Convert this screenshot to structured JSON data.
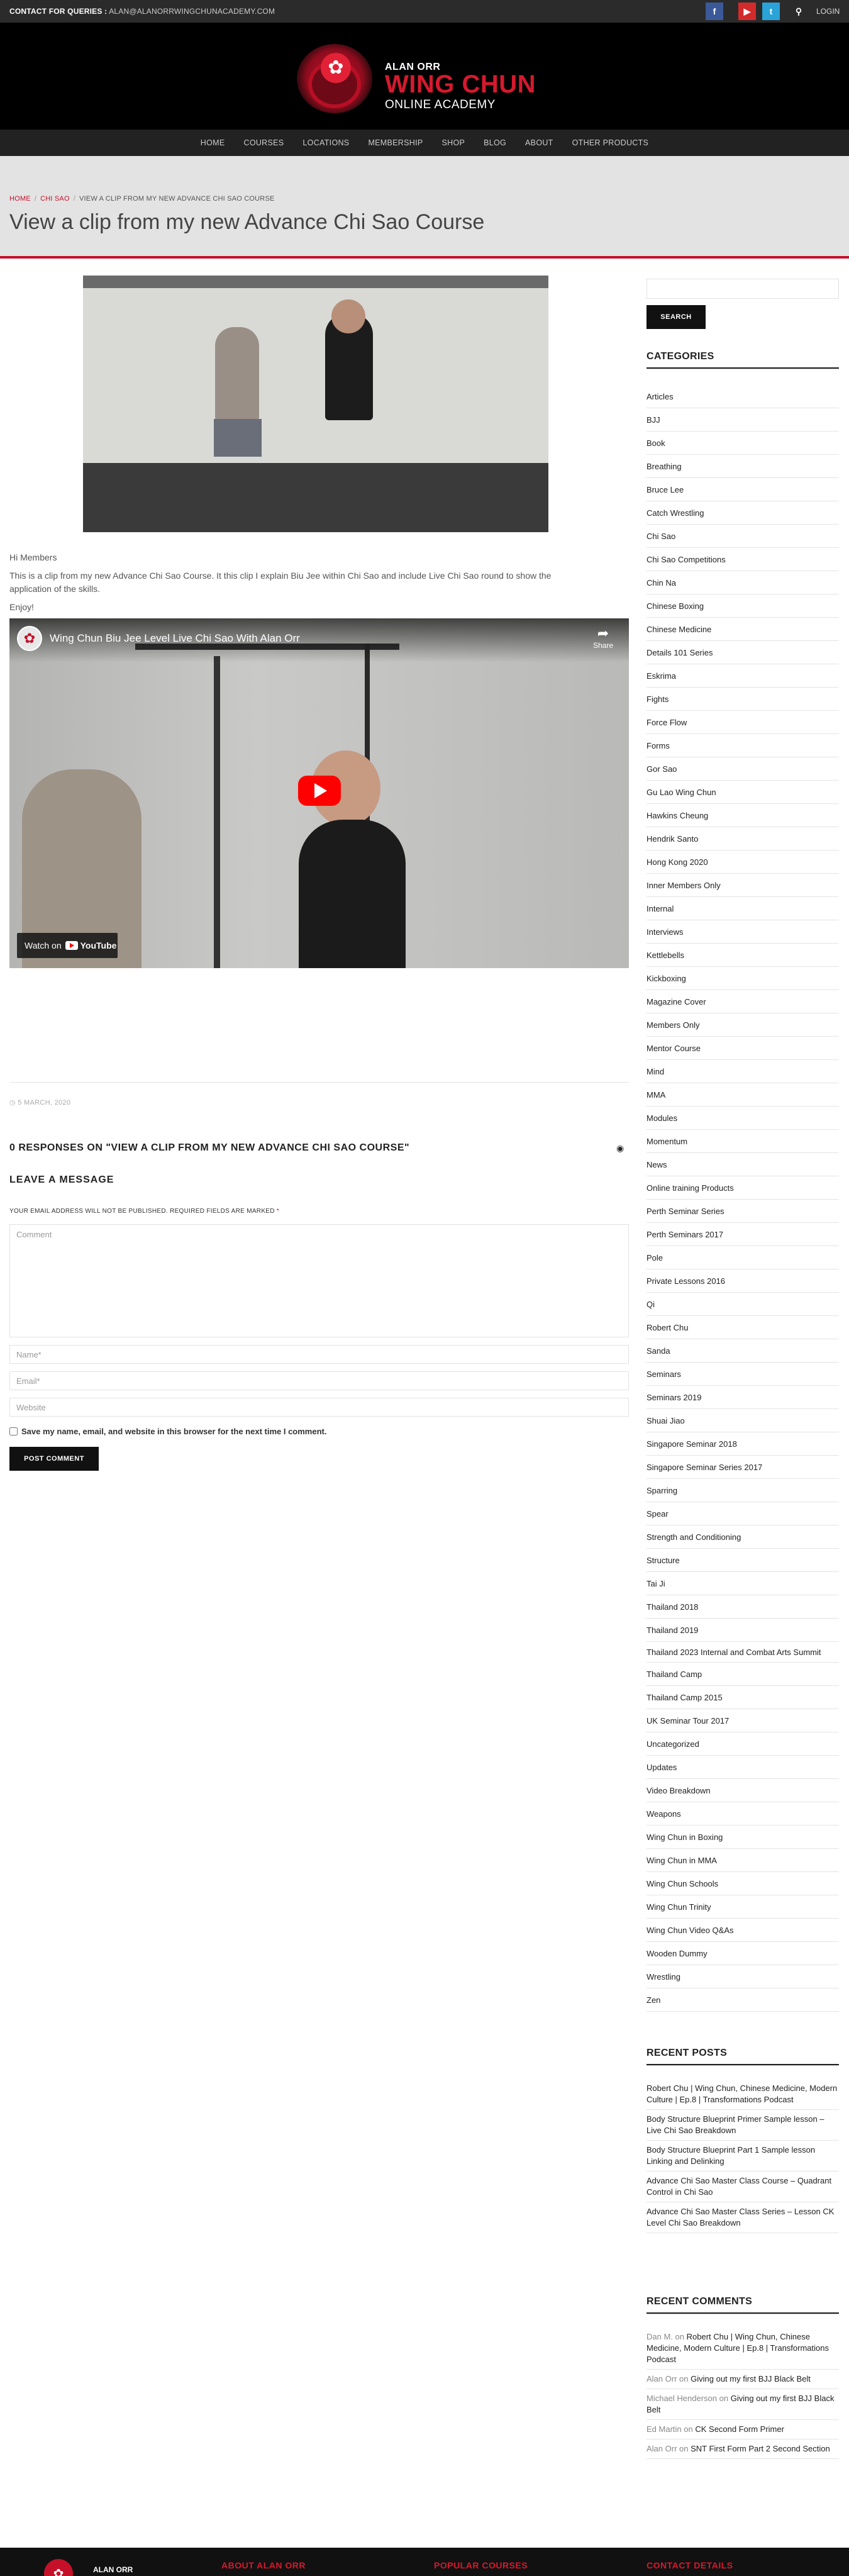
{
  "topbar": {
    "contact_label": "CONTACT FOR QUERIES :",
    "contact_email": "ALAN@ALANORRWINGCHUNACADEMY.COM",
    "facebook_icon": "f",
    "youtube_icon": "▶",
    "twitter_icon": "t",
    "search_icon": "⚲",
    "login": "LOGIN"
  },
  "logo": {
    "line1": "ALAN ORR",
    "line2": "WING CHUN",
    "line3": "ONLINE ACADEMY"
  },
  "nav": [
    "HOME",
    "COURSES",
    "LOCATIONS",
    "MEMBERSHIP",
    "SHOP",
    "BLOG",
    "ABOUT",
    "OTHER PRODUCTS"
  ],
  "breadcrumb": {
    "home": "HOME",
    "category": "CHI SAO",
    "current": "VIEW A CLIP FROM MY NEW ADVANCE CHI SAO COURSE",
    "separator": "/"
  },
  "page_title": "View a clip from my new Advance Chi Sao Course",
  "content": {
    "greeting": "Hi Members",
    "body": "This is a clip from my new Advance Chi Sao Course. It this clip I explain Biu Jee within Chi Sao and include Live Chi Sao round to show the application of the skills.",
    "signoff": "Enjoy!"
  },
  "video": {
    "title": "Wing Chun Biu Jee Level Live Chi Sao With Alan Orr",
    "share": "Share",
    "watch_on": "Watch on",
    "youtube": "YouTube"
  },
  "post_date": "5 MARCH, 2020",
  "responses_heading": "0 RESPONSES ON \"VIEW A CLIP FROM MY NEW ADVANCE CHI SAO COURSE\"",
  "comment_form": {
    "heading": "LEAVE A MESSAGE",
    "note": "YOUR EMAIL ADDRESS WILL NOT BE PUBLISHED. REQUIRED FIELDS ARE MARKED",
    "required_mark": "*",
    "comment_placeholder": "Comment",
    "name_placeholder": "Name*",
    "email_placeholder": "Email*",
    "website_placeholder": "Website",
    "save_label": "Save my name, email, and website in this browser for the next time I comment.",
    "submit": "POST COMMENT"
  },
  "sidebar": {
    "search_button": "SEARCH",
    "categories_heading": "CATEGORIES",
    "categories": [
      "Articles",
      "BJJ",
      "Book",
      "Breathing",
      "Bruce Lee",
      "Catch Wrestling",
      "Chi Sao",
      "Chi Sao Competitions",
      "Chin Na",
      "Chinese Boxing",
      "Chinese Medicine",
      "Details 101 Series",
      "Eskrima",
      "Fights",
      "Force Flow",
      "Forms",
      "Gor Sao",
      "Gu Lao Wing Chun",
      "Hawkins Cheung",
      "Hendrik Santo",
      "Hong Kong 2020",
      "Inner Members Only",
      "Internal",
      "Interviews",
      "Kettlebells",
      "Kickboxing",
      "Magazine Cover",
      "Members Only",
      "Mentor Course",
      "Mind",
      "MMA",
      "Modules",
      "Momentum",
      "News",
      "Online training Products",
      "Perth Seminar Series",
      "Perth Seminars 2017",
      "Pole",
      "Private Lessons 2016",
      "Qi",
      "Robert Chu",
      "Sanda",
      "Seminars",
      "Seminars 2019",
      "Shuai Jiao",
      "Singapore Seminar 2018",
      "Singapore Seminar Series 2017",
      "Sparring",
      "Spear",
      "Strength and Conditioning",
      "Structure",
      "Tai Ji",
      "Thailand 2018",
      "Thailand 2019",
      "Thailand 2023 Internal and Combat Arts Summit",
      "Thailand Camp",
      "Thailand Camp 2015",
      "UK Seminar Tour 2017",
      "Uncategorized",
      "Updates",
      "Video Breakdown",
      "Weapons",
      "Wing Chun in Boxing",
      "Wing Chun in MMA",
      "Wing Chun Schools",
      "Wing Chun Trinity",
      "Wing Chun Video Q&As",
      "Wooden Dummy",
      "Wrestling",
      "Zen"
    ],
    "recent_posts_heading": "RECENT POSTS",
    "recent_posts": [
      "Robert Chu | Wing Chun, Chinese Medicine, Modern Culture | Ep.8 | Transformations Podcast",
      "Body Structure Blueprint Primer Sample lesson – Live Chi Sao Breakdown",
      "Body Structure Blueprint Part 1 Sample lesson Linking and Delinking",
      "Advance Chi Sao Master Class Course – Quadrant Control in Chi Sao",
      "Advance Chi Sao Master Class Series – Lesson CK Level Chi Sao Breakdown"
    ],
    "recent_comments_heading": "RECENT COMMENTS",
    "recent_comments": [
      {
        "author": "Dan M.",
        "on": "on",
        "title": "Robert Chu | Wing Chun, Chinese Medicine, Modern Culture | Ep.8 | Transformations Podcast"
      },
      {
        "author": "Alan Orr",
        "on": "on",
        "title": "Giving out my first BJJ Black Belt"
      },
      {
        "author": "Michael Henderson",
        "on": "on",
        "title": "Giving out my first BJJ Black Belt"
      },
      {
        "author": "Ed Martin",
        "on": "on",
        "title": "CK Second Form Primer"
      },
      {
        "author": "Alan Orr",
        "on": "on",
        "title": "SNT First Form Part 2 Second Section"
      }
    ]
  },
  "footer": {
    "logo_name": "ALAN ORR",
    "about": "ABOUT ALAN ORR",
    "courses": "POPULAR COURSES",
    "contact": "CONTACT DETAILS"
  }
}
